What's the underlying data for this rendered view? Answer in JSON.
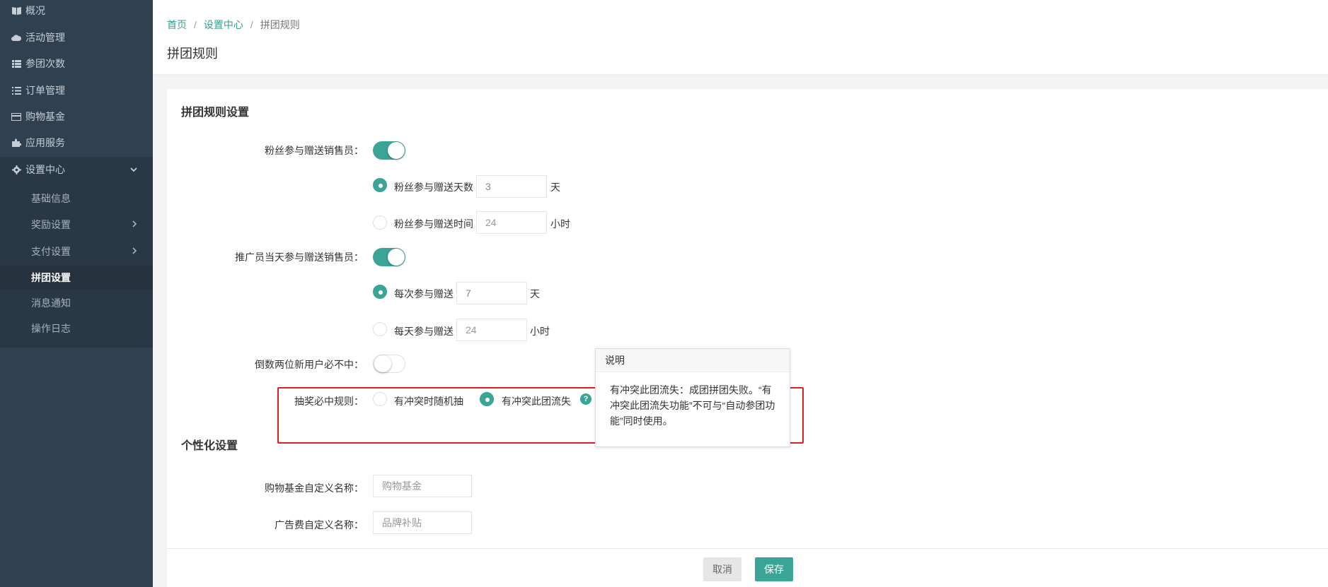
{
  "sidebar": {
    "items": [
      {
        "label": "概况",
        "icon": "book-icon"
      },
      {
        "label": "活动管理",
        "icon": "cloud-icon"
      },
      {
        "label": "参团次数",
        "icon": "list-icon"
      },
      {
        "label": "订单管理",
        "icon": "list-ul-icon"
      },
      {
        "label": "购物基金",
        "icon": "card-icon"
      },
      {
        "label": "应用服务",
        "icon": "puzzle-icon"
      },
      {
        "label": "设置中心",
        "icon": "gear-icon"
      }
    ],
    "sub_items": [
      {
        "label": "基础信息"
      },
      {
        "label": "奖励设置"
      },
      {
        "label": "支付设置"
      },
      {
        "label": "拼团设置"
      },
      {
        "label": "消息通知"
      },
      {
        "label": "操作日志"
      }
    ]
  },
  "breadcrumb": {
    "home": "首页",
    "sep": "/",
    "settings": "设置中心",
    "current": "拼团规则"
  },
  "page_title": "拼团规则",
  "rules": {
    "section_title": "拼团规则设置",
    "fans": {
      "label": "粉丝参与赠送销售员：",
      "enabled": true,
      "option_days_label": "粉丝参与赠送天数",
      "days_value": "3",
      "days_unit": "天",
      "option_hours_label": "粉丝参与赠送时间",
      "hours_placeholder": "24",
      "hours_unit": "小时"
    },
    "promoter": {
      "label": "推广员当天参与赠送销售员：",
      "enabled": true,
      "option_each_label": "每次参与赠送",
      "each_value": "7",
      "each_unit": "天",
      "option_daily_label": "每天参与赠送",
      "daily_placeholder": "24",
      "daily_unit": "小时"
    },
    "countdown": {
      "label": "倒数两位新用户必不中：",
      "enabled": false
    },
    "lottery": {
      "label": "抽奖必中规则：",
      "option_random": "有冲突时随机抽",
      "option_fail": "有冲突此团流失",
      "help": "?"
    }
  },
  "popover": {
    "title": "说明",
    "body": "有冲突此团流失：成团拼团失败。“有冲突此团流失功能”不可与“自动参团功能”同时使用。"
  },
  "personal": {
    "section_title": "个性化设置",
    "fund_label": "购物基金自定义名称：",
    "fund_placeholder": "购物基金",
    "ad_label": "广告费自定义名称：",
    "ad_placeholder": "品牌补贴"
  },
  "footer": {
    "cancel": "取消",
    "save": "保存"
  },
  "colors": {
    "accent": "#3aa597",
    "sidebar_bg": "#2f4050",
    "highlight": "#e02020"
  }
}
